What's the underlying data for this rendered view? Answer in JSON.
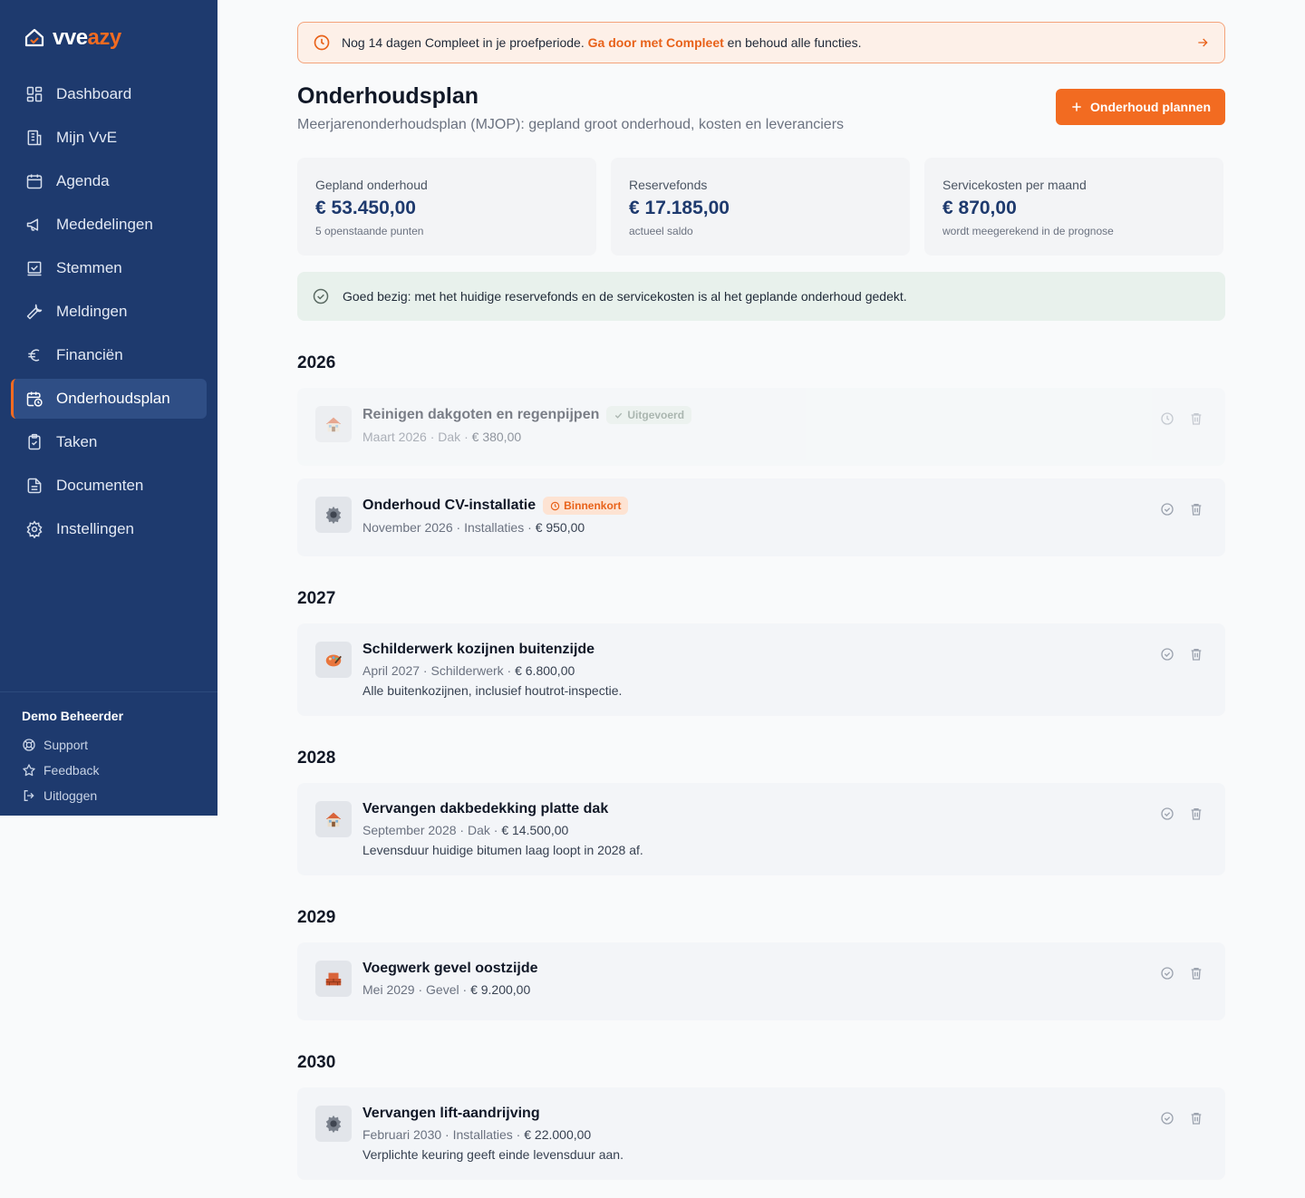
{
  "app": {
    "logo_a": "vve",
    "logo_b": "azy"
  },
  "sidebar": {
    "items": [
      {
        "label": "Dashboard",
        "icon": "dashboard-icon"
      },
      {
        "label": "Mijn VvE",
        "icon": "building-icon"
      },
      {
        "label": "Agenda",
        "icon": "calendar-icon"
      },
      {
        "label": "Mededelingen",
        "icon": "megaphone-icon"
      },
      {
        "label": "Stemmen",
        "icon": "vote-icon"
      },
      {
        "label": "Meldingen",
        "icon": "wrench-icon"
      },
      {
        "label": "Financiën",
        "icon": "euro-icon"
      },
      {
        "label": "Onderhoudsplan",
        "icon": "calendar-clock-icon"
      },
      {
        "label": "Taken",
        "icon": "clipboard-check-icon"
      },
      {
        "label": "Documenten",
        "icon": "document-icon"
      },
      {
        "label": "Instellingen",
        "icon": "gear-icon"
      }
    ],
    "active": "Onderhoudsplan",
    "user": "Demo Beheerder",
    "footer_links": [
      "Support",
      "Feedback",
      "Uitloggen"
    ]
  },
  "trial_banner": {
    "text_before": "Nog 14 dagen Compleet in je proefperiode. ",
    "link": "Ga door met Compleet",
    "text_after": " en behoud alle functies."
  },
  "header": {
    "title": "Onderhoudsplan",
    "subtitle": "Meerjarenonderhoudsplan (MJOP): gepland groot onderhoud, kosten en leveranciers",
    "primary_button": "Onderhoud plannen"
  },
  "stats": [
    {
      "label": "Gepland onderhoud",
      "value": "€ 53.450,00",
      "note": "5 openstaande punten"
    },
    {
      "label": "Reservefonds",
      "value": "€ 17.185,00",
      "note": "actueel saldo"
    },
    {
      "label": "Servicekosten per maand",
      "value": "€ 870,00",
      "note": "wordt meegerekend in de prognose"
    }
  ],
  "coverage_message": "Goed bezig: met het huidige reservefonds en de servicekosten is al het geplande onderhoud gedekt.",
  "years": [
    {
      "year": "2026",
      "items": [
        {
          "title": "Reinigen dakgoten en regenpijpen",
          "badge": "Uitgevoerd",
          "badge_type": "green",
          "date": "Maart 2026",
          "category": "Dak",
          "amount": "€ 380,00",
          "desc": "",
          "icon": "house-icon",
          "done": true
        },
        {
          "title": "Onderhoud CV-installatie",
          "badge": "Binnenkort",
          "badge_type": "orange",
          "date": "November 2026",
          "category": "Installaties",
          "amount": "€ 950,00",
          "desc": "",
          "icon": "cog-icon",
          "done": false
        }
      ]
    },
    {
      "year": "2027",
      "items": [
        {
          "title": "Schilderwerk kozijnen buitenzijde",
          "badge": "",
          "badge_type": "",
          "date": "April 2027",
          "category": "Schilderwerk",
          "amount": "€ 6.800,00",
          "desc": "Alle buitenkozijnen, inclusief houtrot-inspectie.",
          "icon": "paint-icon",
          "done": false
        }
      ]
    },
    {
      "year": "2028",
      "items": [
        {
          "title": "Vervangen dakbedekking platte dak",
          "badge": "",
          "badge_type": "",
          "date": "September 2028",
          "category": "Dak",
          "amount": "€ 14.500,00",
          "desc": "Levensduur huidige bitumen laag loopt in 2028 af.",
          "icon": "house-icon",
          "done": false
        }
      ]
    },
    {
      "year": "2029",
      "items": [
        {
          "title": "Voegwerk gevel oostzijde",
          "badge": "",
          "badge_type": "",
          "date": "Mei 2029",
          "category": "Gevel",
          "amount": "€ 9.200,00",
          "desc": "",
          "icon": "brick-icon",
          "done": false
        }
      ]
    },
    {
      "year": "2030",
      "items": [
        {
          "title": "Vervangen lift-aandrijving",
          "badge": "",
          "badge_type": "",
          "date": "Februari 2030",
          "category": "Installaties",
          "amount": "€ 22.000,00",
          "desc": "Verplichte keuring geeft einde levensduur aan.",
          "icon": "cog-icon",
          "done": false
        }
      ]
    }
  ]
}
